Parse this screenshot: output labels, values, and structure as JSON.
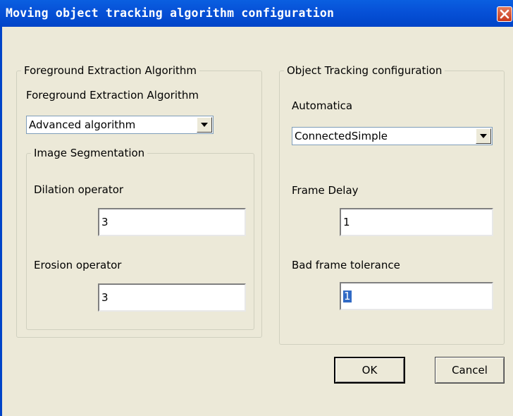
{
  "window": {
    "title": "Moving object tracking algorithm configuration"
  },
  "foreground": {
    "group_label": "Foreground Extraction Algorithm",
    "label": "Foreground Extraction Algorithm",
    "algorithm_value": "Advanced algorithm",
    "segmentation": {
      "group_label": "Image Segmentation",
      "dilation_label": "Dilation operator",
      "dilation_value": "3",
      "erosion_label": "Erosion operator",
      "erosion_value": "3"
    }
  },
  "tracking": {
    "group_label": "Object Tracking configuration",
    "automatica_label": "Automatica",
    "automatica_value": "ConnectedSimple",
    "frame_delay_label": "Frame Delay",
    "frame_delay_value": "1",
    "bad_frame_label": "Bad frame tolerance",
    "bad_frame_value": "1"
  },
  "buttons": {
    "ok": "OK",
    "cancel": "Cancel"
  }
}
